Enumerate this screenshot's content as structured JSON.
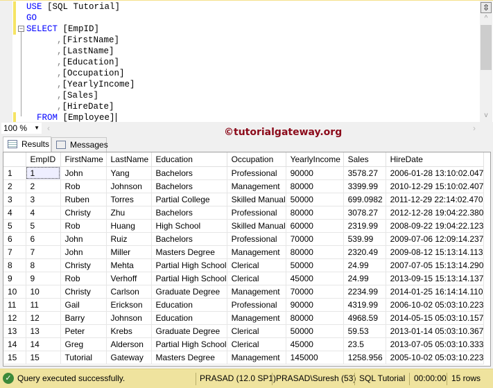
{
  "editor": {
    "lines": [
      {
        "kw": "USE",
        "rest": " [SQL Tutorial]"
      },
      {
        "kw": "GO",
        "rest": ""
      },
      {
        "kw": "SELECT",
        "rest": " [EmpID]"
      },
      {
        "comma": ",",
        "rest": "[FirstName]"
      },
      {
        "comma": ",",
        "rest": "[LastName]"
      },
      {
        "comma": ",",
        "rest": "[Education]"
      },
      {
        "comma": ",",
        "rest": "[Occupation]"
      },
      {
        "comma": ",",
        "rest": "[YearlyIncome]"
      },
      {
        "comma": ",",
        "rest": "[Sales]"
      },
      {
        "comma": ",",
        "rest": "[HireDate]"
      },
      {
        "kw": "FROM",
        "rest": " [Employee]"
      }
    ]
  },
  "zoom": "100 %",
  "watermark": "©tutorialgateway.org",
  "tabs": [
    {
      "label": "Results",
      "active": true
    },
    {
      "label": "Messages",
      "active": false
    }
  ],
  "grid": {
    "columns": [
      "EmpID",
      "FirstName",
      "LastName",
      "Education",
      "Occupation",
      "YearlyIncome",
      "Sales",
      "HireDate"
    ],
    "rows": [
      [
        "1",
        "John",
        "Yang",
        "Bachelors",
        "Professional",
        "90000",
        "3578.27",
        "2006-01-28 13:10:02.047"
      ],
      [
        "2",
        "Rob",
        "Johnson",
        "Bachelors",
        "Management",
        "80000",
        "3399.99",
        "2010-12-29 15:10:02.407"
      ],
      [
        "3",
        "Ruben",
        "Torres",
        "Partial College",
        "Skilled Manual",
        "50000",
        "699.0982",
        "2011-12-29 22:14:02.470"
      ],
      [
        "4",
        "Christy",
        "Zhu",
        "Bachelors",
        "Professional",
        "80000",
        "3078.27",
        "2012-12-28 19:04:22.380"
      ],
      [
        "5",
        "Rob",
        "Huang",
        "High School",
        "Skilled Manual",
        "60000",
        "2319.99",
        "2008-09-22 19:04:22.123"
      ],
      [
        "6",
        "John",
        "Ruiz",
        "Bachelors",
        "Professional",
        "70000",
        "539.99",
        "2009-07-06 12:09:14.237"
      ],
      [
        "7",
        "John",
        "Miller",
        "Masters Degree",
        "Management",
        "80000",
        "2320.49",
        "2009-08-12 15:13:14.113"
      ],
      [
        "8",
        "Christy",
        "Mehta",
        "Partial High School",
        "Clerical",
        "50000",
        "24.99",
        "2007-07-05 15:13:14.290"
      ],
      [
        "9",
        "Rob",
        "Verhoff",
        "Partial High School",
        "Clerical",
        "45000",
        "24.99",
        "2013-09-15 15:13:14.137"
      ],
      [
        "10",
        "Christy",
        "Carlson",
        "Graduate Degree",
        "Management",
        "70000",
        "2234.99",
        "2014-01-25 16:14:14.110"
      ],
      [
        "11",
        "Gail",
        "Erickson",
        "Education",
        "Professional",
        "90000",
        "4319.99",
        "2006-10-02 05:03:10.223"
      ],
      [
        "12",
        "Barry",
        "Johnson",
        "Education",
        "Management",
        "80000",
        "4968.59",
        "2014-05-15 05:03:10.157"
      ],
      [
        "13",
        "Peter",
        "Krebs",
        "Graduate Degree",
        "Clerical",
        "50000",
        "59.53",
        "2013-01-14 05:03:10.367"
      ],
      [
        "14",
        "Greg",
        "Alderson",
        "Partial High School",
        "Clerical",
        "45000",
        "23.5",
        "2013-07-05 05:03:10.333"
      ],
      [
        "15",
        "Tutorial",
        "Gateway",
        "Masters Degree",
        "Management",
        "145000",
        "1258.956",
        "2005-10-02 05:03:10.223"
      ]
    ]
  },
  "status": {
    "message": "Query executed successfully.",
    "server": "PRASAD (12.0 SP1)",
    "user": "PRASAD\\Suresh (53)",
    "database": "SQL Tutorial",
    "time": "00:00:00",
    "rows": "15 rows",
    "bg_color": "#efe39e"
  }
}
